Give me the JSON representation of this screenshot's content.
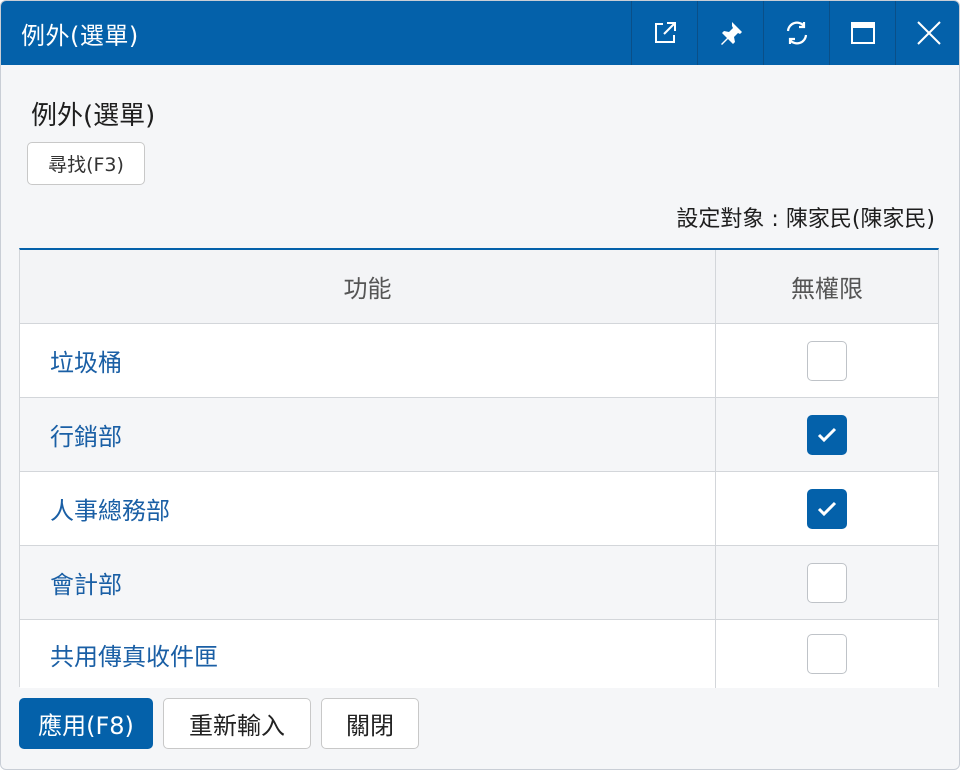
{
  "window": {
    "title": "例外(選單)",
    "controls": [
      "popout-icon",
      "pin-icon",
      "refresh-icon",
      "maximize-icon",
      "close-icon"
    ]
  },
  "heading": "例外(選單)",
  "find_button": "尋找(F3)",
  "target_label": "設定對象 : 陳家民(陳家民)",
  "table": {
    "columns": [
      "功能",
      "無權限"
    ],
    "rows": [
      {
        "name": "垃圾桶",
        "checked": false
      },
      {
        "name": "行銷部",
        "checked": true
      },
      {
        "name": "人事總務部",
        "checked": true
      },
      {
        "name": "會計部",
        "checked": false
      },
      {
        "name": "共用傳真收件匣",
        "checked": false
      }
    ]
  },
  "buttons": {
    "apply": "應用(F8)",
    "reset": "重新輸入",
    "close": "關閉"
  },
  "colors": {
    "accent": "#0461aa",
    "link": "#1a5fa5"
  }
}
